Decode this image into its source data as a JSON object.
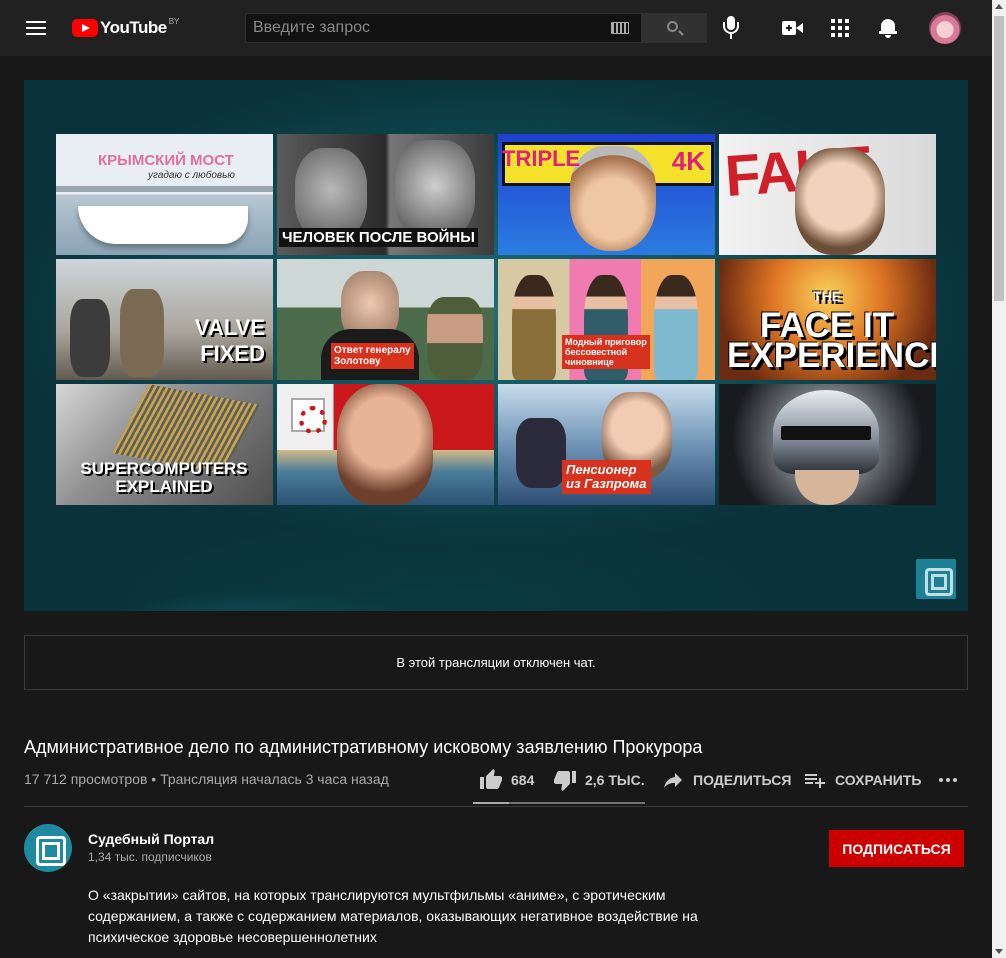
{
  "header": {
    "logo_text": "YouTube",
    "country_code": "BY",
    "search_placeholder": "Введите запрос"
  },
  "player": {
    "thumbnails": [
      {
        "caption": "КРЫМСКИЙ МОСТ",
        "subcaption": "угадаю с любовью"
      },
      {
        "caption": "ЧЕЛОВЕК ПОСЛЕ ВОЙНЫ"
      },
      {
        "caption_left": "TRIPLE",
        "caption_right": "4K"
      },
      {
        "caption": "FAKE"
      },
      {
        "caption_line1": "VALVE",
        "caption_line2": "FIXED"
      },
      {
        "caption_line1": "Ответ генералу",
        "caption_line2": "Золотову"
      },
      {
        "caption_line1": "Модный приговор",
        "caption_line2": "бессовестной",
        "caption_line3": "чиновнице"
      },
      {
        "caption_small": "THE",
        "caption_line1": "FACE IT",
        "caption_line2": "EXPERIENCE"
      },
      {
        "caption_line1": "SUPERCOMPUTERS",
        "caption_line2": "EXPLAINED"
      },
      {
        "caption": ""
      },
      {
        "caption_line1": "Пенсионер",
        "caption_line2": "из Газпрома"
      },
      {
        "caption": ""
      }
    ]
  },
  "chat": {
    "message": "В этой трансляции отключен чат."
  },
  "video": {
    "title": "Административное дело по административному исковому заявлению Прокурора",
    "meta": "17 712 просмотров • Трансляция началась 3 часа назад",
    "likes": "684",
    "dislikes": "2,6 ТЫС.",
    "share_label": "ПОДЕЛИТЬСЯ",
    "save_label": "СОХРАНИТЬ",
    "like_ratio": 0.21
  },
  "channel": {
    "name": "Судебный Портал",
    "subscribers": "1,34 тыс. подписчиков",
    "subscribe_label": "ПОДПИСАТЬСЯ"
  },
  "description": {
    "text": "О «закрытии» сайтов, на которых транслируются мультфильмы «аниме», с эротическим содержанием, а также с содержанием материалов, оказывающих негативное воздействие на психическое здоровье несовершеннолетних"
  },
  "colors": {
    "accent_red": "#cc0000",
    "channel_teal": "#1e8aa0",
    "background": "#181818"
  }
}
